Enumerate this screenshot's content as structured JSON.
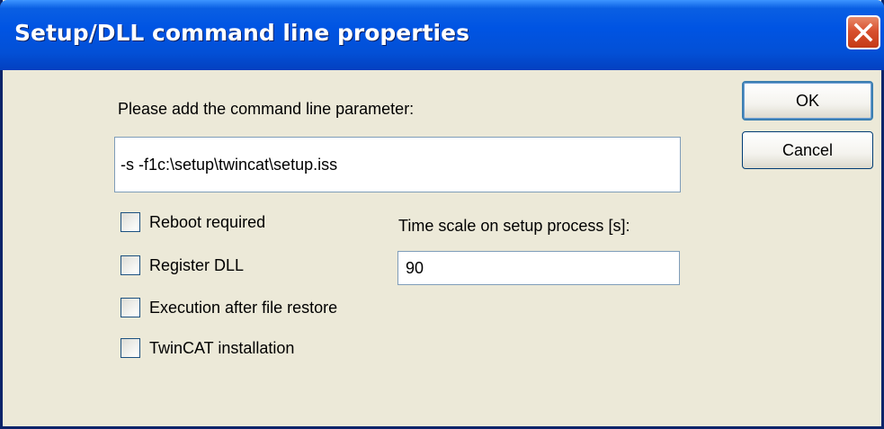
{
  "window": {
    "title": "Setup/DLL command line properties"
  },
  "form": {
    "param_label": "Please add the command line parameter:",
    "param_value": "-s -f1c:\\setup\\twincat\\setup.iss",
    "checkboxes": [
      {
        "label": "Reboot required",
        "checked": false
      },
      {
        "label": "Register DLL",
        "checked": false
      },
      {
        "label": "Execution after file restore",
        "checked": false
      },
      {
        "label": "TwinCAT installation",
        "checked": false
      }
    ],
    "time_label": "Time scale on setup process [s]:",
    "time_value": "90"
  },
  "buttons": {
    "ok": "OK",
    "cancel": "Cancel"
  },
  "icons": {
    "close": "close-icon"
  },
  "colors": {
    "titlebar": "#0054e3",
    "dialog_bg": "#ece9d8",
    "close_button": "#d8512f"
  }
}
